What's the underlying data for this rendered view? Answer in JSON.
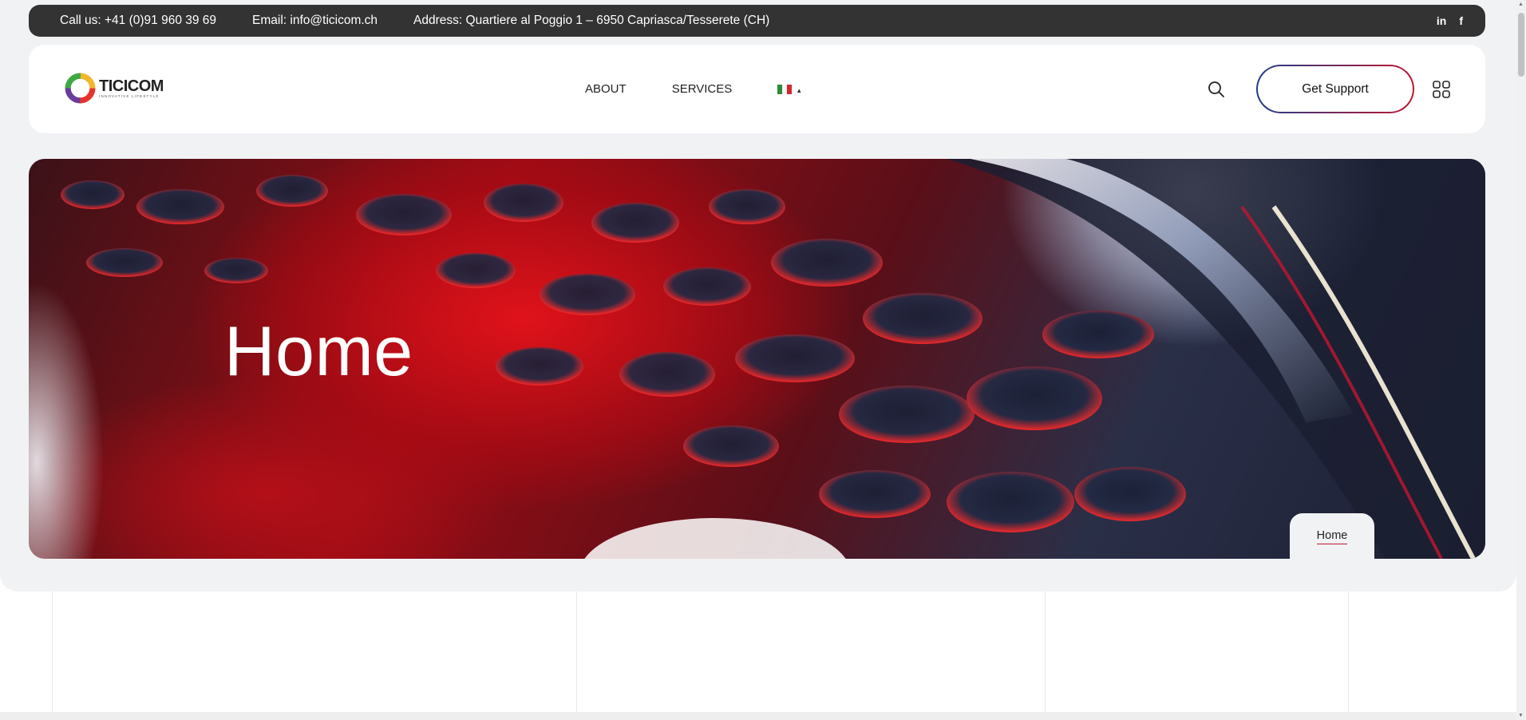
{
  "topbar": {
    "phone": "Call us: +41 (0)91 960 39 69",
    "email": "Email: info@ticicom.ch",
    "address": "Address: Quartiere al Poggio 1 – 6950 Capriasca/Tesserete (CH)",
    "social": [
      "in",
      "f"
    ]
  },
  "logo": {
    "name": "TICICOM",
    "tagline": "INNOVATIVE LIFESTYLE"
  },
  "nav": {
    "items": [
      "ABOUT",
      "SERVICES"
    ],
    "language": {
      "icon": "italy-flag-icon",
      "colors": [
        "#2e8b3a",
        "#ffffff",
        "#d3262f"
      ]
    }
  },
  "actions": {
    "search_icon": "search-icon",
    "support_label": "Get Support",
    "menu_icon": "grid-icon"
  },
  "hero": {
    "title": "Home",
    "breadcrumb": "Home"
  },
  "colors": {
    "topbar_bg": "#333333",
    "accent_red": "#c0162f",
    "accent_blue": "#203a8a",
    "page_bg": "#f1f2f4"
  }
}
